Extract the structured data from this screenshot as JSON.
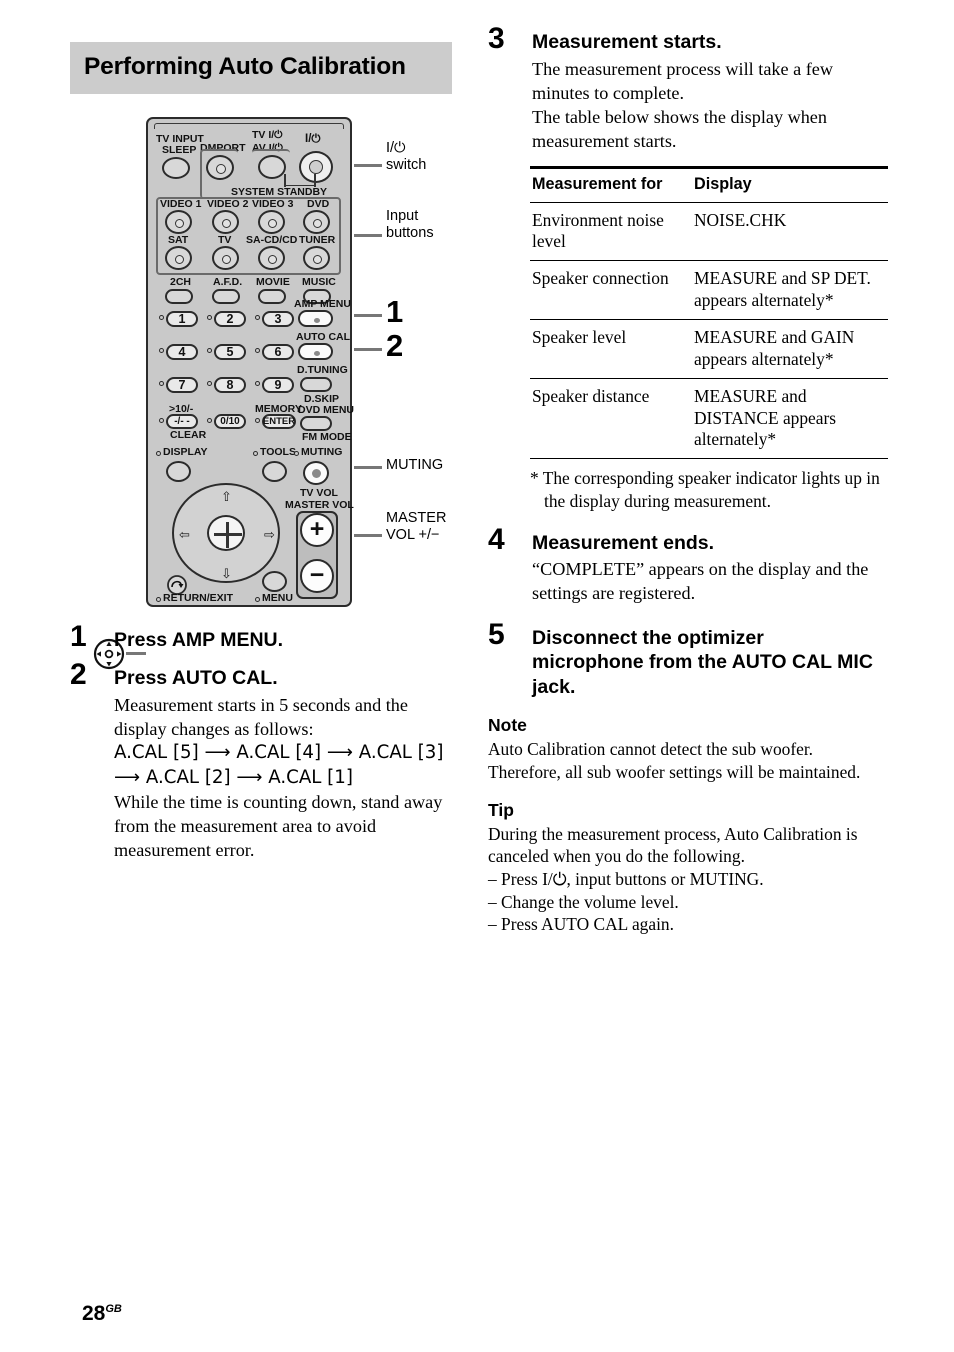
{
  "section": {
    "heading": "Performing Auto Calibration"
  },
  "remote": {
    "labels": {
      "tv_input": "TV INPUT",
      "sleep": "SLEEP",
      "dmport": "DMPORT",
      "tv_power": "TV I/⏻",
      "av_power": "AV I/⏻",
      "main_power": "I/⏻",
      "system_standby": "SYSTEM STANDBY",
      "video1": "VIDEO 1",
      "video2": "VIDEO 2",
      "video3": "VIDEO 3",
      "dvd": "DVD",
      "sat": "SAT",
      "tv": "TV",
      "sacd_cd": "SA-CD/CD",
      "tuner": "TUNER",
      "two_ch": "2CH",
      "afd": "A.F.D.",
      "movie": "MOVIE",
      "music": "MUSIC",
      "amp_menu": "AMP MENU",
      "auto_cal": "AUTO CAL",
      "d_tuning": "D.TUNING",
      "d_skip": "D.SKIP",
      "dvd_menu": "DVD MENU",
      "fm_mode": "FM MODE",
      "memory": "MEMORY",
      "enter": "ENTER",
      "gt10": ">10/-",
      "dashdash": "-/- -",
      "clear": "CLEAR",
      "zero_ten": "0/10",
      "display": "DISPLAY",
      "tools": "TOOLS",
      "muting": "MUTING",
      "tv_vol": "TV VOL",
      "master_vol": "MASTER VOL",
      "return_exit": "RETURN/EXIT",
      "menu": "MENU",
      "vol_plus": "+",
      "vol_minus": "−",
      "key1": "1",
      "key2": "2",
      "key3": "3",
      "key4": "4",
      "key5": "5",
      "key6": "6",
      "key7": "7",
      "key8": "8",
      "key9": "9"
    },
    "callouts": {
      "power_switch": "I/⏻\nswitch",
      "input_buttons": "Input\nbuttons",
      "num_one": "1",
      "num_two": "2",
      "muting": "MUTING",
      "master_vol": "MASTER\nVOL +/−"
    }
  },
  "steps": [
    {
      "num": "1",
      "title": "Press AMP MENU.",
      "body": []
    },
    {
      "num": "2",
      "title": "Press AUTO CAL.",
      "body": [
        "Measurement starts in 5 seconds and the display changes as follows:",
        "A.CAL [5] ⟶ A.CAL [4] ⟶ A.CAL [3] ⟶ A.CAL [2] ⟶ A.CAL [1]",
        "While the time is counting down, stand away from the measurement area to avoid measurement error."
      ]
    },
    {
      "num": "3",
      "title": "Measurement starts.",
      "body": [
        "The measurement process will take a few minutes to complete.",
        "The table below shows the display when measurement starts."
      ]
    },
    {
      "num": "4",
      "title": "Measurement ends.",
      "body": [
        "“COMPLETE” appears on the display and the settings are registered."
      ]
    },
    {
      "num": "5",
      "title": "Disconnect the optimizer microphone from the AUTO CAL MIC jack.",
      "body": []
    }
  ],
  "table": {
    "headers": [
      "Measurement for",
      "Display"
    ],
    "rows": [
      [
        "Environment noise level",
        "NOISE.CHK"
      ],
      [
        "Speaker connection",
        "MEASURE and SP DET. appears alternately*"
      ],
      [
        "Speaker level",
        "MEASURE and GAIN appears alternately*"
      ],
      [
        "Speaker distance",
        "MEASURE and DISTANCE appears alternately*"
      ]
    ],
    "footnote": "* The corresponding speaker indicator lights up in the display during measurement."
  },
  "note": {
    "heading": "Note",
    "text": "Auto Calibration cannot detect the sub woofer. Therefore, all sub woofer settings will be maintained."
  },
  "tip": {
    "heading": "Tip",
    "intro": "During the measurement process, Auto Calibration is canceled when you do the following.",
    "items": [
      "– Press I/⏻, input buttons or MUTING.",
      "– Change the volume level.",
      "– Press AUTO CAL again."
    ]
  },
  "footer": {
    "page_number": "28",
    "page_suffix": "GB"
  },
  "colors": {
    "heading_band": "#cccccc",
    "remote_body": "#c9c9c9",
    "lead_line": "#777777",
    "text": "#000000"
  }
}
